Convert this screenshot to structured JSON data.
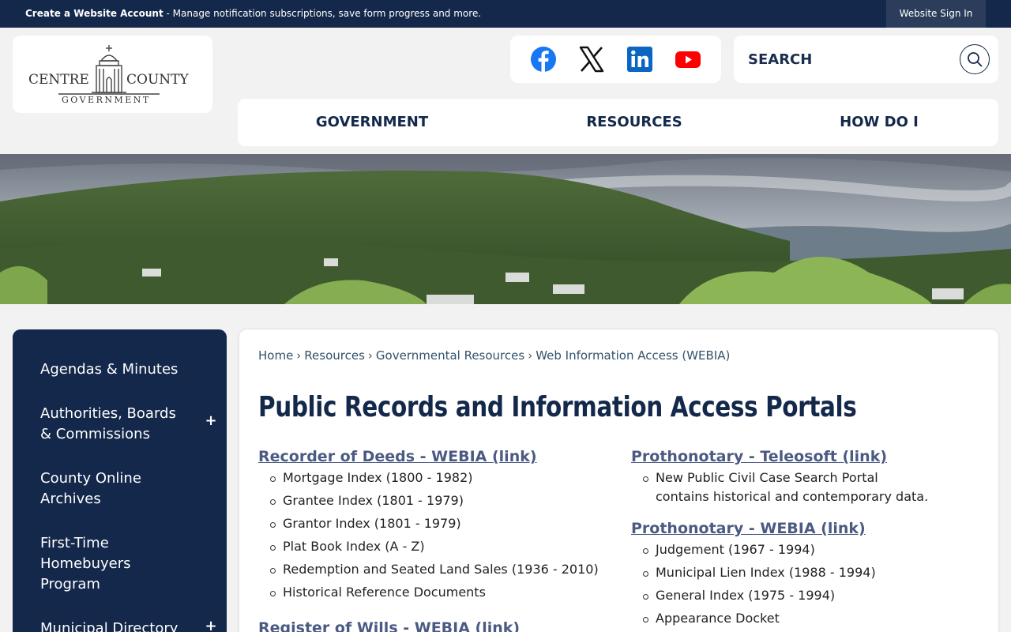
{
  "topbar": {
    "account_link": "Create a Website Account",
    "account_text": " - Manage notification subscriptions, save form progress and more.",
    "sign_in": "Website Sign In"
  },
  "logo": {
    "word_left": "CENTRE",
    "word_right": "COUNTY",
    "word_bottom": "GOVERNMENT"
  },
  "social": {
    "icons": [
      "facebook-icon",
      "x-twitter-icon",
      "linkedin-icon",
      "youtube-icon"
    ]
  },
  "search": {
    "placeholder": "SEARCH"
  },
  "nav": {
    "items": [
      "GOVERNMENT",
      "RESOURCES",
      "HOW DO I"
    ]
  },
  "sidebar": {
    "items": [
      {
        "label": "Agendas & Minutes",
        "expandable": false
      },
      {
        "label": "Authorities, Boards & Commissions",
        "expandable": true
      },
      {
        "label": "County Online Archives",
        "expandable": false
      },
      {
        "label": "First-Time Homebuyers Program",
        "expandable": false
      },
      {
        "label": "Municipal Directory",
        "expandable": true
      }
    ],
    "expand_symbol": "+"
  },
  "breadcrumb": {
    "items": [
      "Home",
      "Resources",
      "Governmental Resources",
      "Web Information Access (WEBIA)"
    ],
    "separator": "›"
  },
  "page": {
    "title": "Public Records and Information Access Portals"
  },
  "sections": {
    "recorder": {
      "heading": "Recorder of Deeds - WEBIA (link)",
      "items": [
        "Mortgage Index (1800 - 1982)",
        "Grantee Index (1801 - 1979)",
        "Grantor Index (1801 - 1979)",
        "Plat Book Index (A - Z)",
        "Redemption and Seated Land Sales (1936 - 2010)",
        "Historical Reference Documents"
      ]
    },
    "register": {
      "heading": "Register of Wills - WEBIA (link)"
    },
    "teleosoft": {
      "heading": "Prothonotary - Teleosoft (link)",
      "items": [
        "New Public Civil Case Search Portal contains historical and contemporary data."
      ]
    },
    "prothonotary_webia": {
      "heading": "Prothonotary - WEBIA (link)",
      "items": [
        "Judgement (1967 - 1994)",
        "Municipal Lien Index (1988 - 1994)",
        "General Index (1975 - 1994)",
        "Appearance Docket"
      ]
    }
  },
  "colors": {
    "navy": "#13284a",
    "link": "#4a5a82",
    "background": "#f2f2f2"
  }
}
